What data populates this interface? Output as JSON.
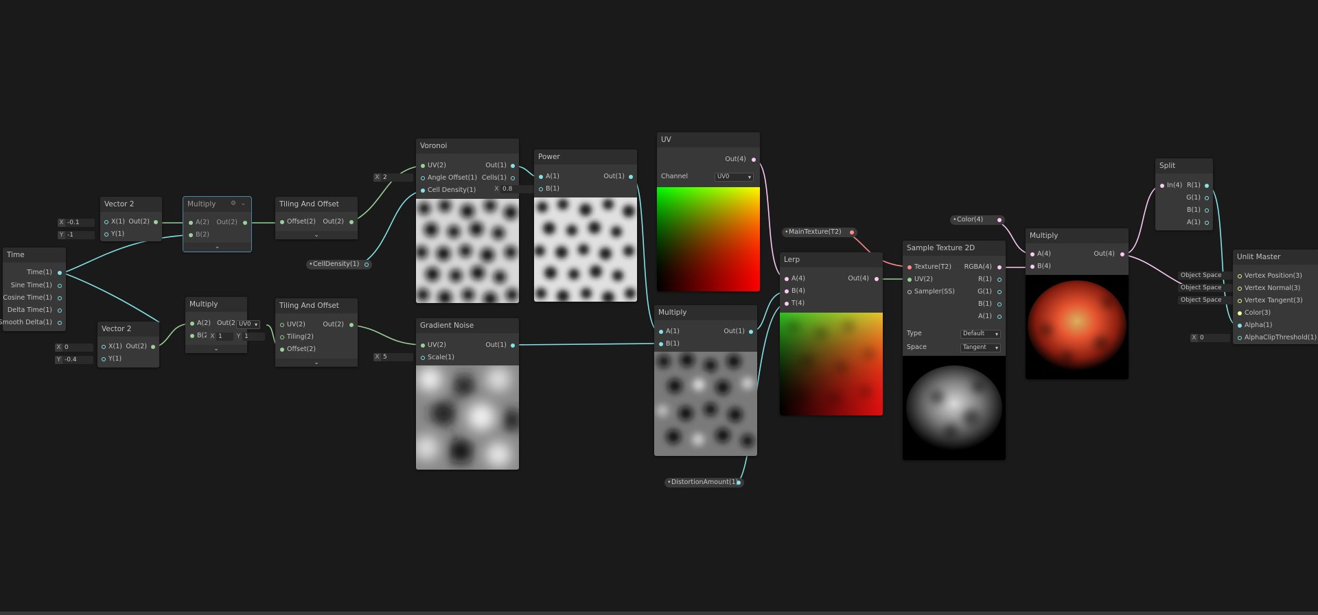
{
  "nodes": {
    "time": {
      "title": "Time",
      "ports": [
        "Time(1)",
        "Sine Time(1)",
        "Cosine Time(1)",
        "Delta Time(1)",
        "Smooth Delta(1)"
      ]
    },
    "vec2a": {
      "title": "Vector 2",
      "in": [
        "X(1)",
        "Y(1)"
      ],
      "out": "Out(2)",
      "x": "-0.1",
      "y": "-1",
      "xaxis": "X",
      "yaxis": "Y"
    },
    "vec2b": {
      "title": "Vector 2",
      "in": [
        "X(1)",
        "Y(1)"
      ],
      "out": "Out(2)",
      "x": "0",
      "y": "-0.4",
      "xaxis": "X",
      "yaxis": "Y"
    },
    "mul1": {
      "title": "Multiply",
      "in": [
        "A(2)",
        "B(2)"
      ],
      "out": "Out(2)"
    },
    "mul2": {
      "title": "Multiply",
      "in": [
        "A(2)",
        "B(2)"
      ],
      "out": "Out(2)",
      "bx": "1",
      "by": "1",
      "bxaxis": "X",
      "byaxis": "Y"
    },
    "tile1": {
      "title": "Tiling And Offset",
      "in": [
        "Offset(2)"
      ],
      "out": "Out(2)"
    },
    "tile2": {
      "title": "Tiling And Offset",
      "in": [
        "UV(2)",
        "Tiling(2)",
        "Offset(2)"
      ],
      "out": "Out(2)",
      "uv": "UV0"
    },
    "voronoi": {
      "title": "Voronoi",
      "in": [
        "UV(2)",
        "Angle Offset(1)",
        "Cell Density(1)"
      ],
      "out": [
        "Out(1)",
        "Cells(1)"
      ],
      "angle": "2",
      "angleaxis": "X"
    },
    "power": {
      "title": "Power",
      "in": [
        "A(1)",
        "B(1)"
      ],
      "out": "Out(1)",
      "b": "0.8",
      "baxis": "X"
    },
    "uv": {
      "title": "UV",
      "out": "Out(4)",
      "channel_label": "Channel",
      "channel": "UV0"
    },
    "gradnoise": {
      "title": "Gradient Noise",
      "in": [
        "UV(2)",
        "Scale(1)"
      ],
      "out": "Out(1)",
      "scale": "5",
      "scaleaxis": "X"
    },
    "mul3": {
      "title": "Multiply",
      "in": [
        "A(1)",
        "B(1)"
      ],
      "out": "Out(1)"
    },
    "lerp": {
      "title": "Lerp",
      "in": [
        "A(4)",
        "B(4)",
        "T(4)"
      ],
      "out": "Out(4)"
    },
    "sample": {
      "title": "Sample Texture 2D",
      "in": [
        "Texture(T2)",
        "UV(2)",
        "Sampler(SS)"
      ],
      "out": [
        "RGBA(4)",
        "R(1)",
        "G(1)",
        "B(1)",
        "A(1)"
      ],
      "type_label": "Type",
      "type": "Default",
      "space_label": "Space",
      "space": "Tangent"
    },
    "mul4": {
      "title": "Multiply",
      "in": [
        "A(4)",
        "B(4)"
      ],
      "out": "Out(4)"
    },
    "split": {
      "title": "Split",
      "in": [
        "In(4)"
      ],
      "out": [
        "R(1)",
        "G(1)",
        "B(1)",
        "A(1)"
      ]
    },
    "master": {
      "title": "Unlit Master",
      "in": [
        "Vertex Position(3)",
        "Vertex Normal(3)",
        "Vertex Tangent(3)",
        "Color(3)",
        "Alpha(1)",
        "AlphaClipThreshold(1)"
      ],
      "space": "Object Space",
      "clip": "0",
      "clipaxis": "X"
    }
  },
  "properties": {
    "celldensity": "CellDensity(1)",
    "maintexture": "MainTexture(T2)",
    "color": "Color(4)",
    "distortion": "DistortionAmount(1)"
  },
  "colors": {
    "background": "#1a1a1a",
    "node": "#383838",
    "header": "#2d2d2d",
    "wire_float": "#84e4e7",
    "wire_vec2": "#9ad29a",
    "wire_vec4": "#fbcbf4",
    "wire_texture": "#ff8b8b",
    "wire_vec3": "#f6ff9a"
  }
}
